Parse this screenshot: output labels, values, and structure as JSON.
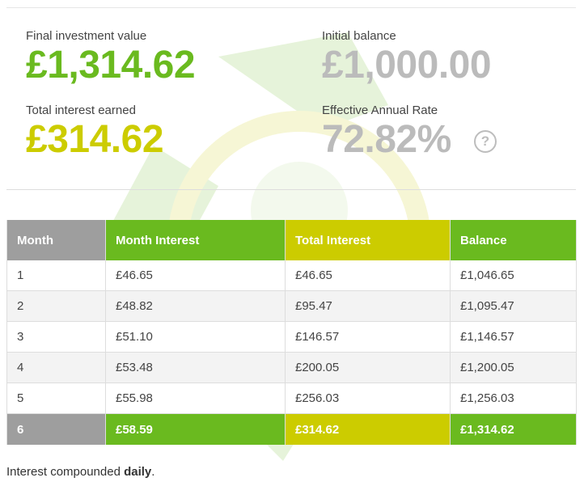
{
  "summary": {
    "final_value_label": "Final investment value",
    "final_value": "£1,314.62",
    "initial_balance_label": "Initial balance",
    "initial_balance": "£1,000.00",
    "interest_label": "Total interest earned",
    "interest": "£314.62",
    "ear_label": "Effective Annual Rate",
    "ear": "72.82%",
    "help_glyph": "?",
    "help_icon": "question-circle-icon"
  },
  "table": {
    "headers": [
      "Month",
      "Month Interest",
      "Total Interest",
      "Balance"
    ],
    "rows": [
      [
        "1",
        "£46.65",
        "£46.65",
        "£1,046.65"
      ],
      [
        "2",
        "£48.82",
        "£95.47",
        "£1,095.47"
      ],
      [
        "3",
        "£51.10",
        "£146.57",
        "£1,146.57"
      ],
      [
        "4",
        "£53.48",
        "£200.05",
        "£1,200.05"
      ],
      [
        "5",
        "£55.98",
        "£256.03",
        "£1,256.03"
      ],
      [
        "6",
        "£58.59",
        "£314.62",
        "£1,314.62"
      ]
    ]
  },
  "footnote": {
    "prefix": "Interest compounded ",
    "frequency": "daily",
    "suffix": "."
  },
  "colors": {
    "green": "#6aba1f",
    "olive": "#cccc00",
    "grey_value": "#bbbbbb",
    "header_grey": "#9e9e9e"
  }
}
